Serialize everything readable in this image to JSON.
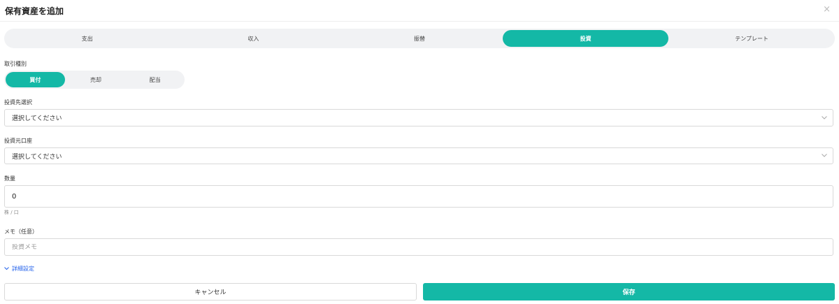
{
  "dialog": {
    "title": "保有資産を追加",
    "close_glyph": "×"
  },
  "tabs": [
    {
      "label": "支出",
      "active": false
    },
    {
      "label": "収入",
      "active": false
    },
    {
      "label": "振替",
      "active": false
    },
    {
      "label": "投資",
      "active": true
    },
    {
      "label": "テンプレート",
      "active": false
    }
  ],
  "transaction_type": {
    "label": "取引種別",
    "options": [
      {
        "label": "買付",
        "active": true
      },
      {
        "label": "売却",
        "active": false
      },
      {
        "label": "配当",
        "active": false
      }
    ]
  },
  "invest_target": {
    "label": "投資先選択",
    "value": "選択してください"
  },
  "source_account": {
    "label": "投資元口座",
    "value": "選択してください"
  },
  "quantity": {
    "label": "数量",
    "value": "0",
    "unit_hint": "株 / 口"
  },
  "memo": {
    "label": "メモ（任意）",
    "placeholder": "投資メモ"
  },
  "details_toggle": {
    "label": "詳細設定"
  },
  "actions": {
    "cancel": "キャンセル",
    "save": "保存"
  },
  "colors": {
    "accent": "#14b8a6",
    "link": "#2563eb"
  }
}
